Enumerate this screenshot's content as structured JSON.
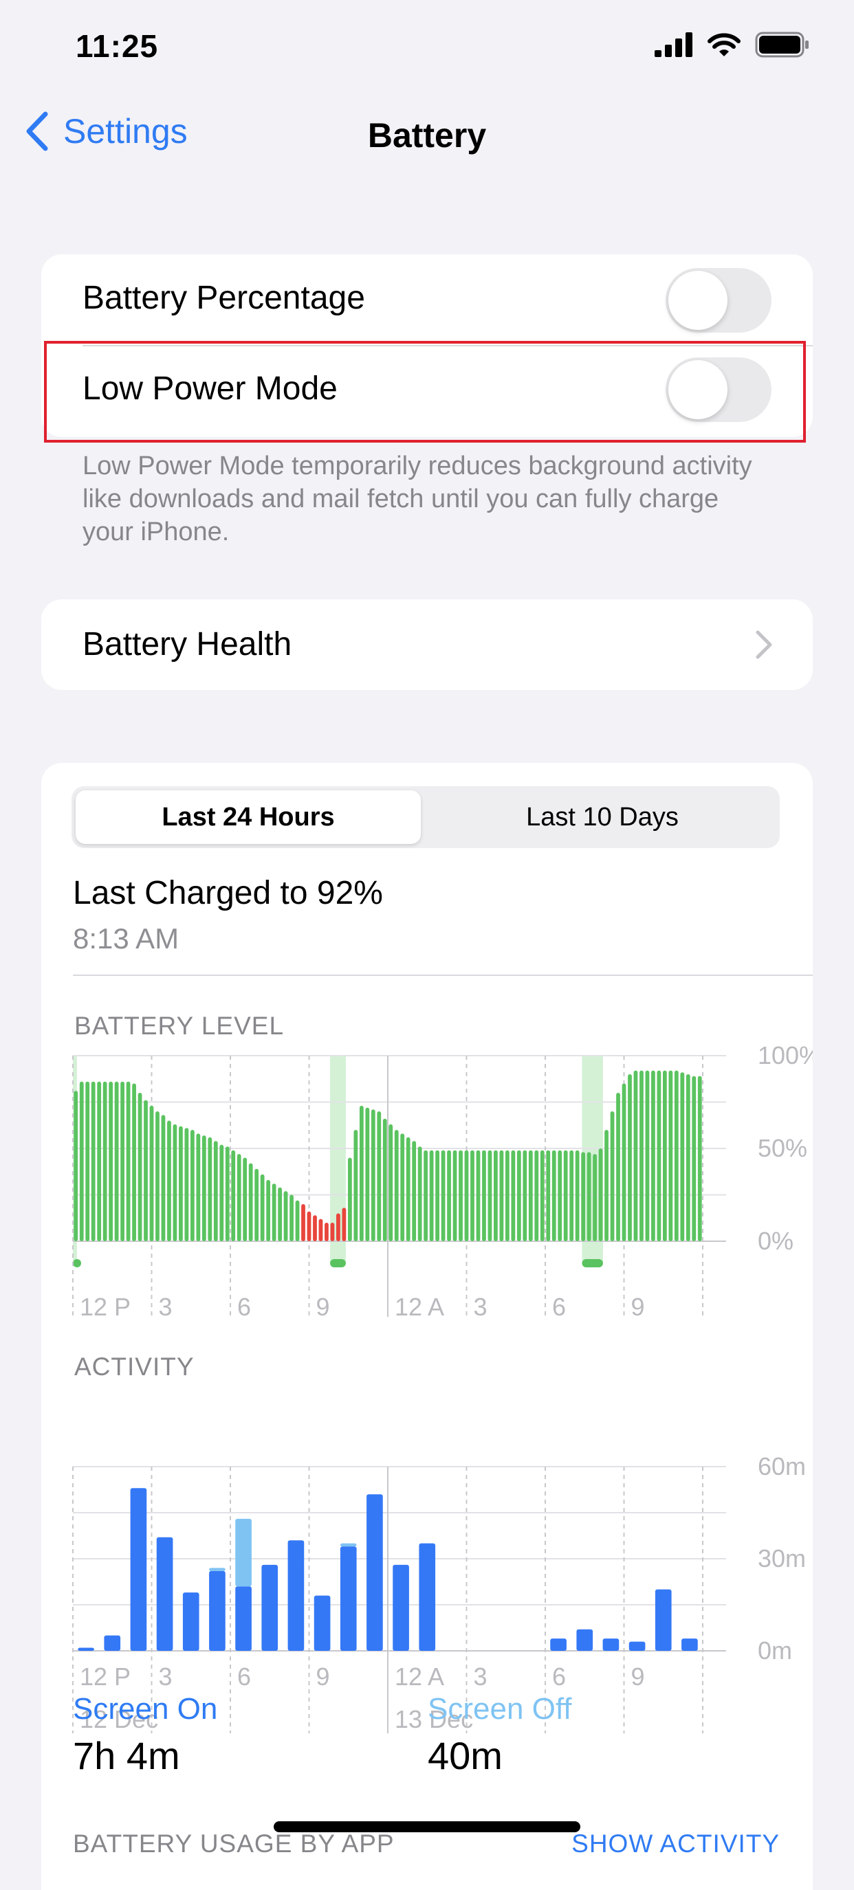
{
  "status": {
    "time": "11:25"
  },
  "nav": {
    "back_label": "Settings",
    "title": "Battery"
  },
  "settings": {
    "battery_percentage": {
      "label": "Battery Percentage",
      "on": false
    },
    "low_power_mode": {
      "label": "Low Power Mode",
      "on": false
    },
    "footnote": "Low Power Mode temporarily reduces background activity like downloads and mail fetch until you can fully charge your iPhone.",
    "battery_health": {
      "label": "Battery Health"
    }
  },
  "usage": {
    "tabs": [
      "Last 24 Hours",
      "Last 10 Days"
    ],
    "selected_tab": 0,
    "last_charged": "Last Charged to 92%",
    "last_charged_time": "8:13 AM"
  },
  "charts": {
    "battery_level_title": "BATTERY LEVEL",
    "activity_title": "ACTIVITY",
    "x_ticks": [
      "12 P",
      "3",
      "6",
      "9",
      "12 A",
      "3",
      "6",
      "9"
    ],
    "date_labels": [
      "12 Dec",
      "13 Dec"
    ],
    "colors": {
      "green": "#5ac35f",
      "red": "#e8453c",
      "charging": "#d4f1d6",
      "blue": "#3478f6",
      "light_blue": "#7fc3f3"
    }
  },
  "chart_data": [
    {
      "type": "bar",
      "title": "BATTERY LEVEL",
      "x_ticks": [
        "12 P",
        "3",
        "6",
        "9",
        "12 A",
        "3",
        "6",
        "9"
      ],
      "y_ticks": [
        "100%",
        "50%",
        "0%"
      ],
      "ylim": [
        0,
        100
      ],
      "values": [
        81,
        86,
        86,
        86,
        86,
        86,
        86,
        86,
        86,
        86,
        85,
        80,
        76,
        73,
        70,
        68,
        65,
        63,
        62,
        61,
        60,
        58,
        57,
        56,
        54,
        52,
        51,
        49,
        47,
        45,
        42,
        39,
        36,
        33,
        31,
        29,
        27,
        25,
        22,
        20,
        16,
        14,
        12,
        10,
        10,
        15,
        18,
        45,
        60,
        73,
        72,
        71,
        70,
        66,
        63,
        60,
        58,
        56,
        54,
        51,
        49,
        49,
        49,
        49,
        49,
        49,
        49,
        49,
        49,
        49,
        49,
        49,
        49,
        49,
        49,
        49,
        49,
        49,
        49,
        49,
        49,
        49,
        49,
        49,
        49,
        49,
        49,
        48,
        48,
        47,
        50,
        60,
        70,
        80,
        85,
        90,
        92,
        92,
        92,
        92,
        92,
        92,
        92,
        92,
        91,
        90,
        89,
        89
      ],
      "low_threshold": 20,
      "charging_periods_hours": [
        [
          0,
          0.1
        ],
        [
          9.8,
          10.4
        ],
        [
          19.4,
          20.2
        ]
      ]
    },
    {
      "type": "bar",
      "title": "ACTIVITY",
      "x_ticks": [
        "12 P",
        "3",
        "6",
        "9",
        "12 A",
        "3",
        "6",
        "9"
      ],
      "y_ticks": [
        "60m",
        "30m",
        "0m"
      ],
      "ylim": [
        0,
        60
      ],
      "categories": [
        "12P",
        "1",
        "2",
        "3",
        "4",
        "5",
        "6",
        "7",
        "8",
        "9",
        "10",
        "11",
        "12A",
        "1",
        "2",
        "3",
        "4",
        "5",
        "6",
        "7",
        "8",
        "9",
        "10",
        "11"
      ],
      "series": [
        {
          "name": "Screen On",
          "values": [
            1,
            5,
            53,
            37,
            19,
            26,
            21,
            28,
            36,
            18,
            34,
            51,
            28,
            35,
            0,
            0,
            0,
            0,
            4,
            7,
            4,
            3,
            20,
            4
          ]
        },
        {
          "name": "Screen Off",
          "values": [
            0,
            0,
            0,
            0,
            0,
            1,
            22,
            0,
            0,
            0,
            1,
            0,
            0,
            0,
            0,
            0,
            0,
            0,
            0,
            0,
            0,
            0,
            0,
            0
          ]
        }
      ]
    }
  ],
  "summary": {
    "screen_on_label": "Screen On",
    "screen_on_value": "7h 4m",
    "screen_off_label": "Screen Off",
    "screen_off_value": "40m"
  },
  "bottom": {
    "usage_by_app": "BATTERY USAGE BY APP",
    "show_activity": "SHOW ACTIVITY"
  }
}
